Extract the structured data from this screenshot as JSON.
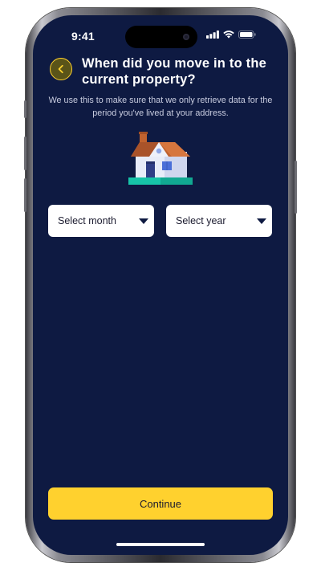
{
  "status_bar": {
    "time": "9:41"
  },
  "header": {
    "back_icon": "chevron-left-icon",
    "title": "When did you move in to the current property?"
  },
  "subtitle": "We use this to make sure that we only retrieve data for the period you've lived at your address.",
  "illustration": {
    "icon": "house-icon"
  },
  "form": {
    "month_select": {
      "value": "Select month"
    },
    "year_select": {
      "value": "Select year"
    }
  },
  "actions": {
    "continue_label": "Continue"
  },
  "colors": {
    "background": "#0e1a42",
    "accent": "#ffd12e",
    "select_bg": "#ffffff",
    "text_primary": "#ffffff",
    "text_secondary": "#c9cde0"
  }
}
